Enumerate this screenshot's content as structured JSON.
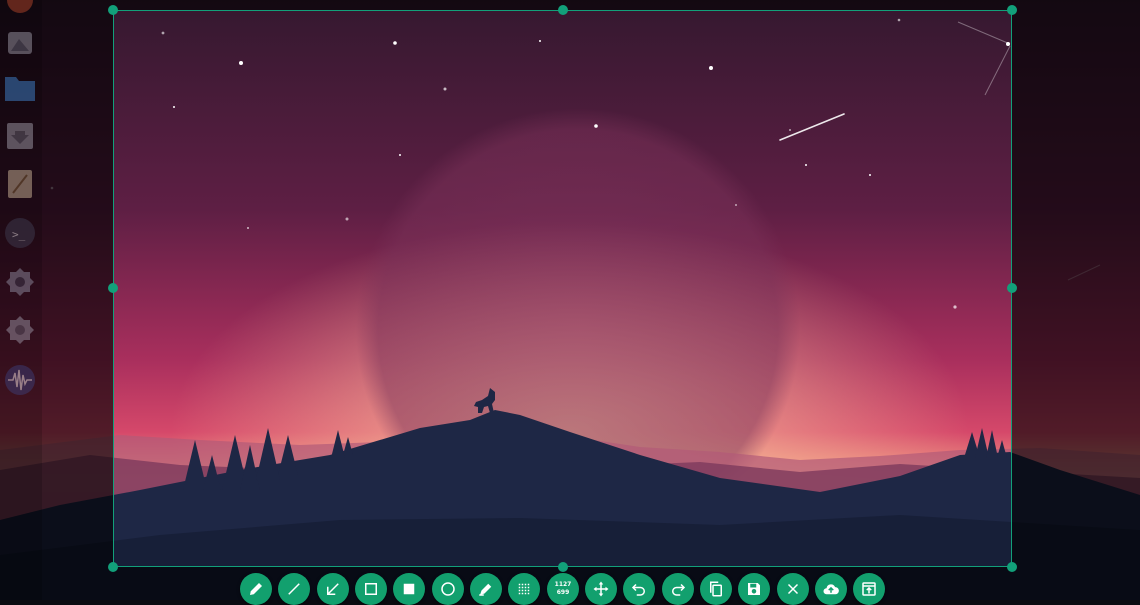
{
  "screenshot_tool": {
    "selection_size": {
      "width": "1127",
      "height": "699"
    },
    "toolbar": [
      {
        "id": "pencil",
        "icon": "pencil-icon"
      },
      {
        "id": "line",
        "icon": "line-icon"
      },
      {
        "id": "arrow",
        "icon": "arrow-icon"
      },
      {
        "id": "rectangle",
        "icon": "rectangle-outline-icon"
      },
      {
        "id": "filled-rectangle",
        "icon": "rectangle-filled-icon"
      },
      {
        "id": "circle",
        "icon": "circle-icon"
      },
      {
        "id": "marker",
        "icon": "marker-icon"
      },
      {
        "id": "pixelate",
        "icon": "pixelate-icon"
      },
      {
        "id": "selection-size",
        "icon": "selection-size-indicator"
      },
      {
        "id": "move",
        "icon": "move-icon"
      },
      {
        "id": "undo",
        "icon": "undo-icon"
      },
      {
        "id": "redo",
        "icon": "redo-icon"
      },
      {
        "id": "copy",
        "icon": "copy-icon"
      },
      {
        "id": "save",
        "icon": "save-icon"
      },
      {
        "id": "exit",
        "icon": "close-icon"
      },
      {
        "id": "upload",
        "icon": "cloud-upload-icon"
      },
      {
        "id": "app-launcher",
        "icon": "open-with-app-icon"
      }
    ]
  },
  "dock": {
    "items": [
      {
        "icon": "app-icon"
      },
      {
        "icon": "image-viewer-icon"
      },
      {
        "icon": "files-folder-icon"
      },
      {
        "icon": "downloads-icon"
      },
      {
        "icon": "text-editor-icon"
      },
      {
        "icon": "terminal-icon"
      },
      {
        "icon": "system-tools-icon"
      },
      {
        "icon": "settings-icon"
      },
      {
        "icon": "audio-waveform-icon"
      }
    ]
  },
  "colors": {
    "accent": "#12a07a",
    "button": "#12a06e",
    "sky_top": "#3a1c34",
    "sky_mid": "#b0325e",
    "horizon_glow": "#f7b58d",
    "hills_far": "#9a4767",
    "hills_near": "#1e2745",
    "foreground": "#171f38"
  }
}
